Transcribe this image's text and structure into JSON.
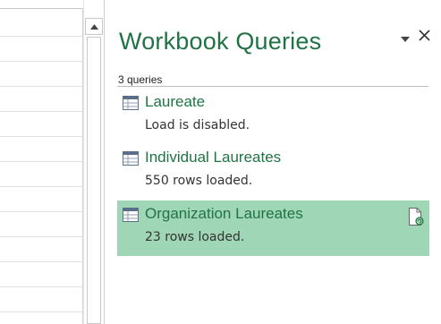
{
  "panel": {
    "title": "Workbook Queries",
    "query_count": "3 queries",
    "accent_color": "#217346",
    "selected_color": "#9fd6b6"
  },
  "queries": [
    {
      "name": "Laureate",
      "status": "Load is disabled.",
      "icon": "table-icon",
      "selected": false
    },
    {
      "name": "Individual Laureates",
      "status": "550 rows loaded.",
      "icon": "table-icon",
      "selected": false
    },
    {
      "name": "Organization Laureates",
      "status": "23 rows loaded.",
      "icon": "table-icon",
      "selected": true
    }
  ],
  "icons": {
    "panel_options": "chevron-down-icon",
    "close": "close-icon",
    "scroll_up": "arrow-up-icon",
    "refresh": "document-refresh-icon"
  }
}
